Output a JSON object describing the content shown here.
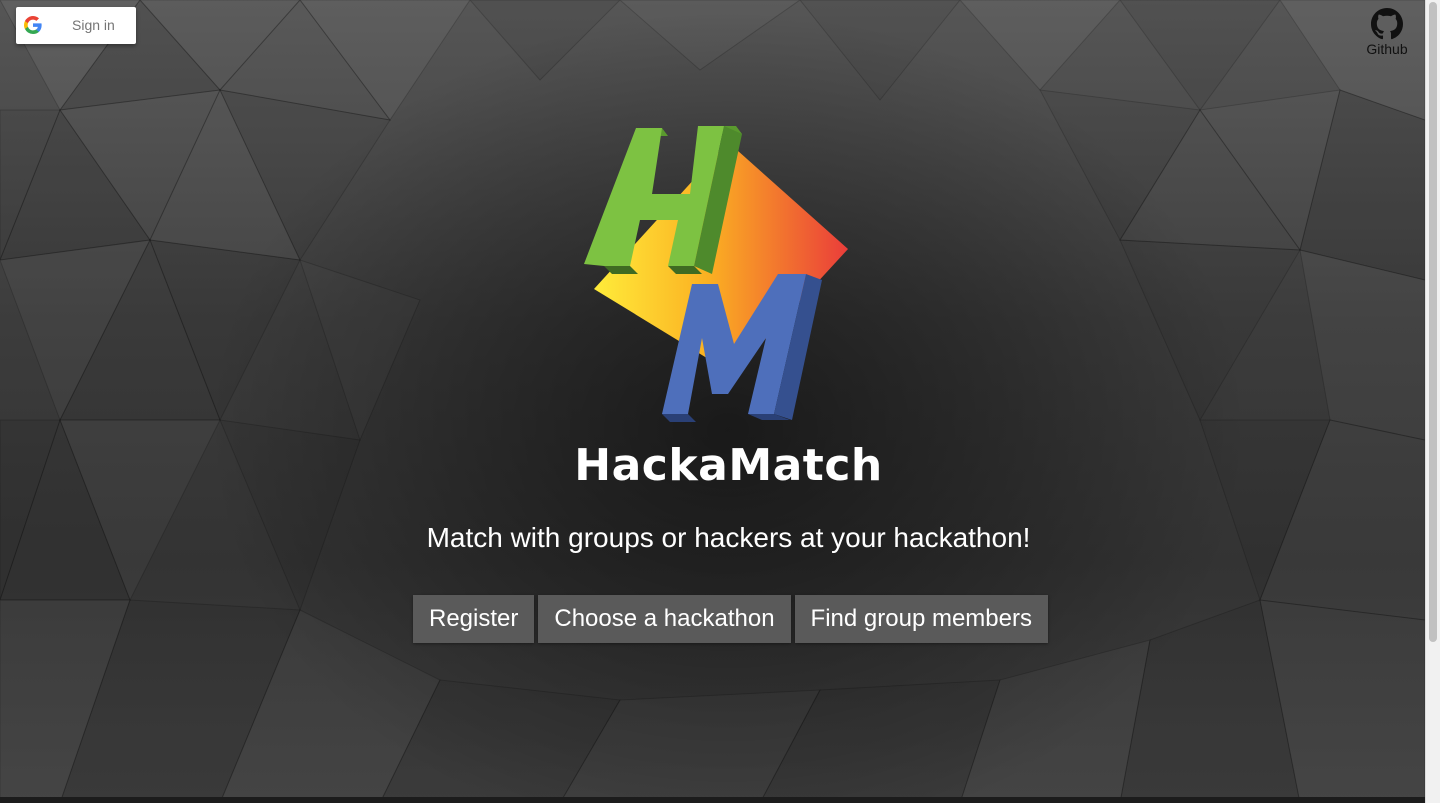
{
  "auth": {
    "signin_label": "Sign in",
    "icon": "google-g-icon"
  },
  "github": {
    "label": "Github",
    "icon": "github-octocat-icon"
  },
  "hero": {
    "logo_letters": "HM",
    "title": "HackaMatch",
    "subtitle": "Match with groups or hackers at your hackathon!"
  },
  "actions": [
    {
      "label": "Register"
    },
    {
      "label": "Choose a hackathon"
    },
    {
      "label": "Find group members"
    }
  ],
  "colors": {
    "h_green": "#7dc242",
    "m_blue": "#4e6fbb",
    "diamond_start": "#ffe83a",
    "diamond_end": "#ea3a3a",
    "button_bg": "#5a5a5a"
  }
}
